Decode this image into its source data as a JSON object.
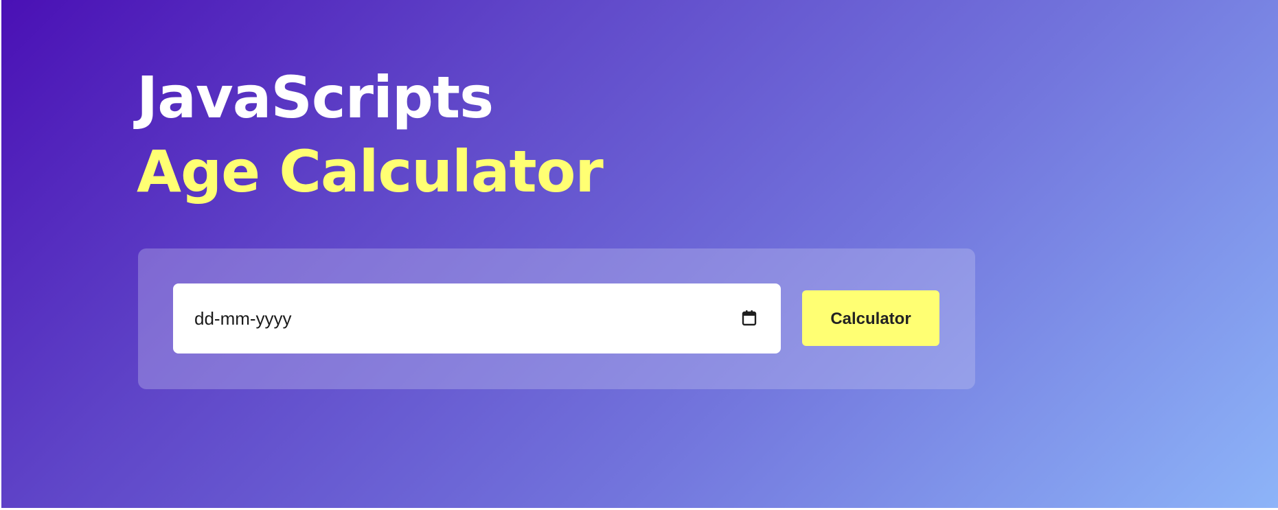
{
  "hero": {
    "title_line_1": "JavaScripts",
    "title_line_2": "Age Calculator"
  },
  "date_input": {
    "placeholder": "dd-mm-yyyy",
    "icon": "calendar-icon"
  },
  "actions": {
    "calculate_label": "Calculator"
  },
  "colors": {
    "gradient_start": "#4a10b5",
    "gradient_end": "#8db4f8",
    "accent_yellow": "#ffff73",
    "title_white": "#ffffff"
  }
}
